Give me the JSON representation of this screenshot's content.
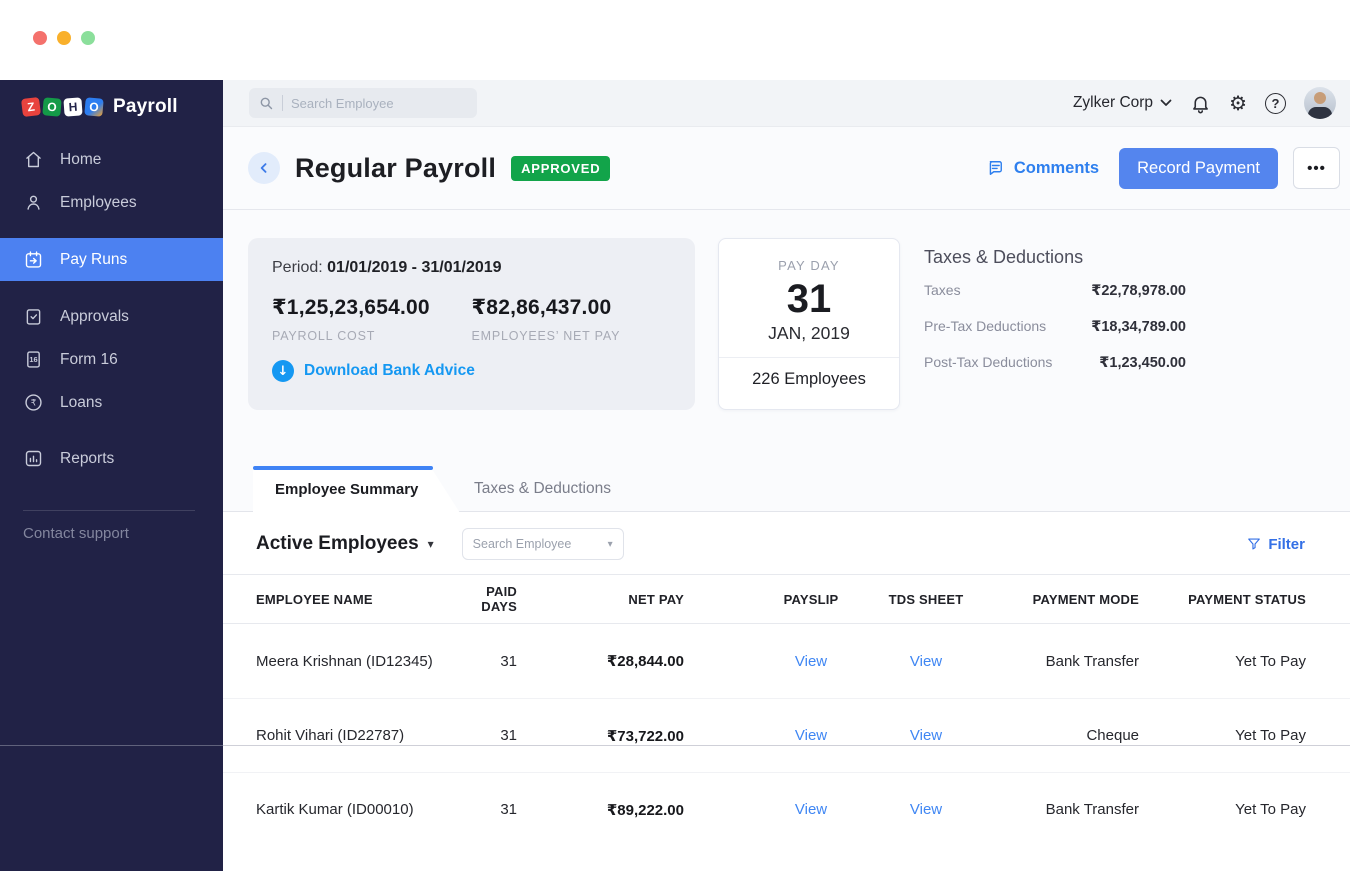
{
  "window": {
    "traffic_light_colors": [
      "#F4716C",
      "#F9B02B",
      "#8BDF9B"
    ]
  },
  "brand": {
    "tiles": [
      {
        "letter": "Z"
      },
      {
        "letter": "O"
      },
      {
        "letter": "H"
      },
      {
        "letter": "O"
      }
    ],
    "product": "Payroll"
  },
  "sidebar": {
    "items": [
      {
        "label": "Home",
        "icon": "home-icon"
      },
      {
        "label": "Employees",
        "icon": "employees-icon"
      },
      {
        "label": "Pay Runs",
        "icon": "pay-runs-icon",
        "active": true
      },
      {
        "label": "Approvals",
        "icon": "approvals-icon"
      },
      {
        "label": "Form 16",
        "icon": "form16-icon"
      },
      {
        "label": "Loans",
        "icon": "loans-icon"
      },
      {
        "label": "Reports",
        "icon": "reports-icon"
      }
    ],
    "footer_link": "Contact support"
  },
  "topbar": {
    "search_placeholder": "Search Employee",
    "org_name": "Zylker Corp"
  },
  "header": {
    "title": "Regular Payroll",
    "status_badge": "APPROVED",
    "comments_label": "Comments",
    "record_payment_label": "Record Payment",
    "more_glyph": "•••"
  },
  "summary": {
    "period_label": "Period:",
    "period_value": "01/01/2019 - 31/01/2019",
    "payroll_cost": "₹1,25,23,654.00",
    "payroll_cost_label": "PAYROLL COST",
    "net_pay": "₹82,86,437.00",
    "net_pay_label": "EMPLOYEES’ NET PAY",
    "download_link": "Download Bank Advice",
    "payday": {
      "label": "PAY DAY",
      "day": "31",
      "month_year": "JAN, 2019",
      "employees": "226 Employees"
    },
    "taxes": {
      "title": "Taxes & Deductions",
      "rows": [
        {
          "label": "Taxes",
          "value": "₹22,78,978.00"
        },
        {
          "label": "Pre-Tax Deductions",
          "value": "₹18,34,789.00"
        },
        {
          "label": "Post-Tax Deductions",
          "value": "₹1,23,450.00"
        }
      ]
    }
  },
  "tabs": {
    "employee_summary": "Employee Summary",
    "taxes_deductions": "Taxes & Deductions"
  },
  "controls": {
    "employee_filter": "Active Employees",
    "search_placeholder": "Search Employee",
    "filter_label": "Filter"
  },
  "table": {
    "columns": [
      "EMPLOYEE NAME",
      "PAID DAYS",
      "NET PAY",
      "PAYSLIP",
      "TDS SHEET",
      "PAYMENT MODE",
      "PAYMENT STATUS"
    ],
    "rows": [
      {
        "name": "Meera Krishnan (ID12345)",
        "paid_days": "31",
        "net_pay": "₹28,844.00",
        "payslip": "View",
        "tds_sheet": "View",
        "payment_mode": "Bank Transfer",
        "payment_status": "Yet To Pay"
      },
      {
        "name": "Rohit Vihari (ID22787)",
        "paid_days": "31",
        "net_pay": "₹73,722.00",
        "payslip": "View",
        "tds_sheet": "View",
        "payment_mode": "Cheque",
        "payment_status": "Yet To Pay"
      },
      {
        "name": "Kartik Kumar (ID00010)",
        "paid_days": "31",
        "net_pay": "₹89,222.00",
        "payslip": "View",
        "tds_sheet": "View",
        "payment_mode": "Bank Transfer",
        "payment_status": "Yet To Pay"
      }
    ]
  },
  "icons": {
    "down_arrow_glyph": "↓",
    "caret_down_glyph": "▾",
    "question_glyph": "?",
    "gear_glyph": "⚙"
  },
  "colors": {
    "sidebar_navy": "#212246",
    "active_item_blue": "#4C81F1",
    "primary_button_blue": "#5485EE",
    "link_blue": "#2E7FEE",
    "download_blue": "#1598F2",
    "approved_green": "#12A44A",
    "tab_accent_blue": "#3F83F5"
  }
}
